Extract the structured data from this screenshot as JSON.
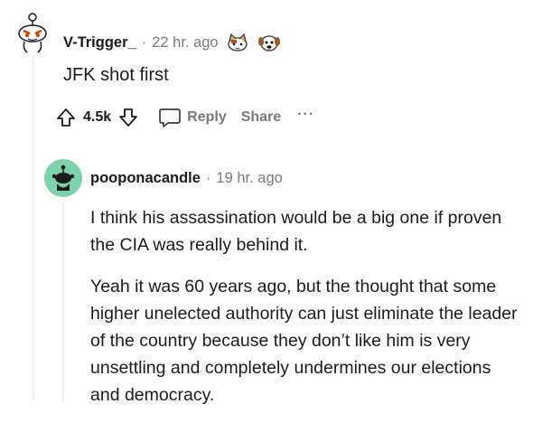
{
  "comment1": {
    "username": "V-Trigger_",
    "separator": "·",
    "time": "22 hr. ago",
    "awards": [
      "cat-award-icon",
      "dog-award-icon"
    ],
    "body": "JFK shot first",
    "actions": {
      "upvote_icon": "upvote-icon",
      "vote_count": "4.5k",
      "downvote_icon": "downvote-icon",
      "reply_icon": "reply-bubble-icon",
      "reply_label": "Reply",
      "share_label": "Share",
      "more_icon": "more-icon",
      "more_label": "···"
    }
  },
  "comment2": {
    "username": "pooponacandle",
    "separator": "·",
    "time": "19 hr. ago",
    "paragraphs": [
      "I think his assassination would be a big one if proven the CIA was really behind it.",
      "Yeah it was 60 years ago, but the thought that some higher unelected authority can just eliminate the leader of the country because they don’t like him is very unsettling and completely undermines our elections and democracy."
    ]
  },
  "colors": {
    "text": "#1c1c1c",
    "meta": "#7c7c7c",
    "thread_line": "#edeff1",
    "avatar2_bg": "#7bd3ad"
  }
}
